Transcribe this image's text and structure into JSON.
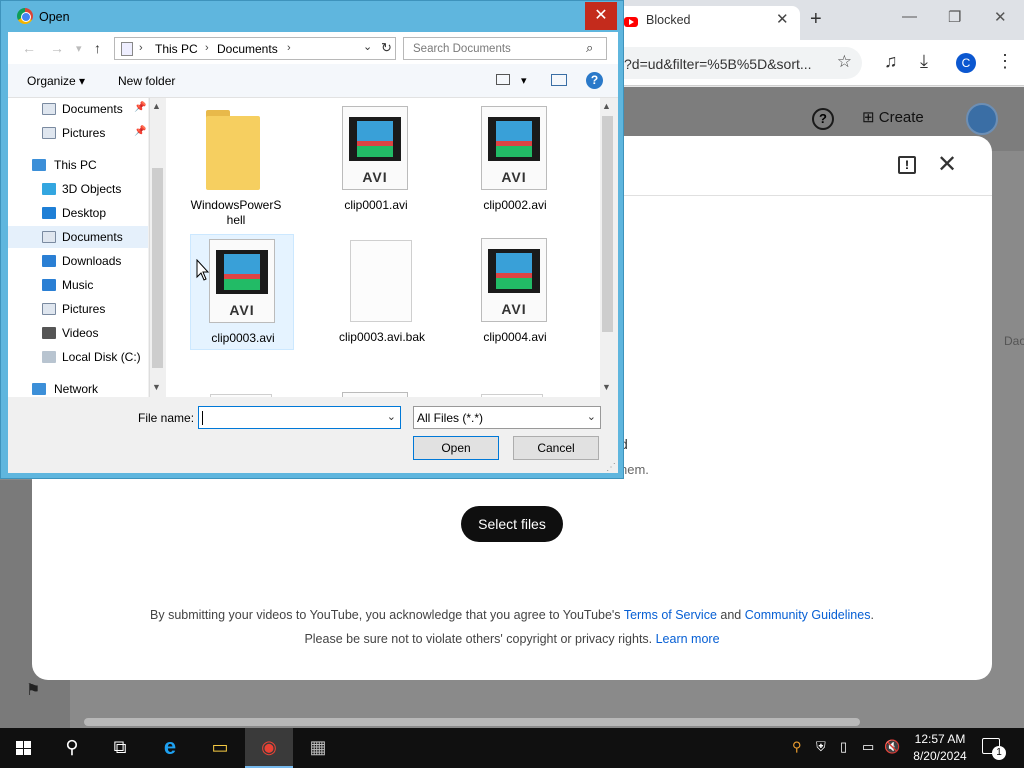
{
  "chrome": {
    "tab_title": "Blocked",
    "tab_close": "✕",
    "new_tab": "+",
    "min": "—",
    "restore": "❐",
    "close": "✕",
    "url": "?d=ud&filter=%5B%5D&sort...",
    "star": "☆",
    "download": "⤓",
    "media": "♫",
    "profile_initial": "C",
    "menu": "⋮"
  },
  "studio": {
    "help": "?",
    "create_label": "Create",
    "create_icon": "⊞",
    "side_hint": "Dao"
  },
  "upload_modal": {
    "feedback": "!",
    "close": "✕",
    "drag_hint": "d",
    "privacy_hint": "hem.",
    "select_files": "Select files",
    "legal_line1_prefix": "By submitting your videos to YouTube, you acknowledge that you agree to YouTube's ",
    "terms_link": "Terms of Service",
    "legal_line1_and": " and ",
    "guidelines_link": "Community Guidelines",
    "legal_line1_suffix": ".",
    "legal_line2_prefix": "Please be sure not to violate others' copyright or privacy rights. ",
    "learn_more": "Learn more"
  },
  "dialog": {
    "title": "Open",
    "close": "✕",
    "back": "←",
    "forward": "→",
    "recent": "▾",
    "up": "↑",
    "breadcrumbs": [
      "This PC",
      "Documents"
    ],
    "crumb_sep": "›",
    "addr_drop": "⌄",
    "refresh": "↻",
    "search_placeholder": "Search Documents",
    "search_icon": "⌕",
    "organize": "Organize ▾",
    "new_folder": "New folder",
    "view_drop": "▾",
    "help": "?",
    "nav": [
      {
        "label": "Documents",
        "pinned": true
      },
      {
        "label": "Pictures",
        "pinned": true
      },
      {
        "label": "This PC"
      },
      {
        "label": "3D Objects"
      },
      {
        "label": "Desktop"
      },
      {
        "label": "Documents",
        "selected": true
      },
      {
        "label": "Downloads"
      },
      {
        "label": "Music"
      },
      {
        "label": "Pictures"
      },
      {
        "label": "Videos"
      },
      {
        "label": "Local Disk (C:)"
      },
      {
        "label": "Network"
      }
    ],
    "pin_glyph": "📌",
    "files": [
      {
        "name": "WindowsPowerShell",
        "name_line1": "WindowsPowerS",
        "name_line2": "hell",
        "kind": "folder"
      },
      {
        "name": "clip0001.avi",
        "kind": "avi"
      },
      {
        "name": "clip0002.avi",
        "kind": "avi"
      },
      {
        "name": "clip0003.avi",
        "kind": "avi",
        "selected": true
      },
      {
        "name": "clip0003.avi.bak",
        "kind": "blank"
      },
      {
        "name": "clip0004.avi",
        "kind": "avi"
      },
      {
        "name": "",
        "kind": "blank"
      },
      {
        "name": "",
        "kind": "avi"
      },
      {
        "name": "",
        "kind": "toggle"
      }
    ],
    "avi_caption": "AVI",
    "file_name_label": "File name:",
    "file_name_value": "",
    "file_type": "All Files (*.*)",
    "dropdown_arrow": "⌄",
    "open_button": "Open",
    "cancel_button": "Cancel",
    "scroll_up": "▲",
    "scroll_down": "▼",
    "grip": "⋰"
  },
  "taskbar": {
    "search_icon": "⚲",
    "taskview_icon": "⧉",
    "ie_icon": "e",
    "explorer_icon": "▭",
    "chrome_icon": "◉",
    "app_icon": "▦",
    "tray_icons": [
      "⚲",
      "⛨",
      "▯",
      "▭",
      "🔇"
    ],
    "time": "12:57 AM",
    "date": "8/20/2024",
    "notifications": "1"
  }
}
